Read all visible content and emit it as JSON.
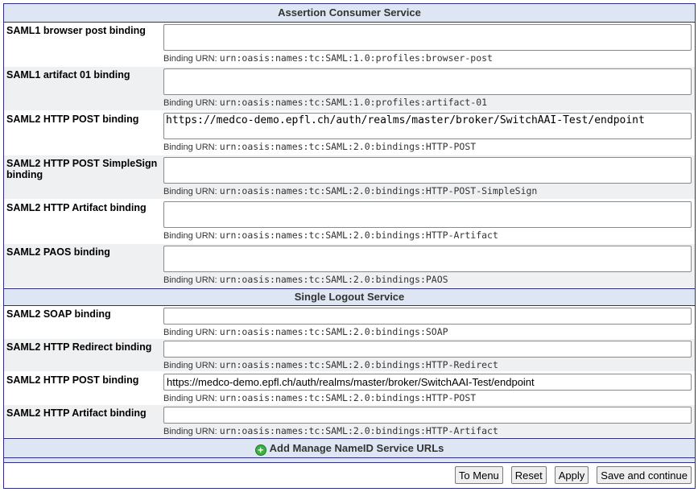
{
  "sections": {
    "acs": {
      "title": "Assertion Consumer Service",
      "urn_prefix": "Binding URN:",
      "rows": [
        {
          "label": "SAML1 browser post binding",
          "value": "",
          "urn": "urn:oasis:names:tc:SAML:1.0:profiles:browser-post"
        },
        {
          "label": "SAML1 artifact 01 binding",
          "value": "",
          "urn": "urn:oasis:names:tc:SAML:1.0:profiles:artifact-01"
        },
        {
          "label": "SAML2 HTTP POST binding",
          "value": "https://medco-demo.epfl.ch/auth/realms/master/broker/SwitchAAI-Test/endpoint",
          "urn": "urn:oasis:names:tc:SAML:2.0:bindings:HTTP-POST"
        },
        {
          "label": "SAML2 HTTP POST SimpleSign binding",
          "value": "",
          "urn": "urn:oasis:names:tc:SAML:2.0:bindings:HTTP-POST-SimpleSign"
        },
        {
          "label": "SAML2 HTTP Artifact binding",
          "value": "",
          "urn": "urn:oasis:names:tc:SAML:2.0:bindings:HTTP-Artifact"
        },
        {
          "label": "SAML2 PAOS binding",
          "value": "",
          "urn": "urn:oasis:names:tc:SAML:2.0:bindings:PAOS"
        }
      ]
    },
    "slo": {
      "title": "Single Logout Service",
      "urn_prefix": "Binding URN:",
      "rows": [
        {
          "label": "SAML2 SOAP binding",
          "value": "",
          "urn": "urn:oasis:names:tc:SAML:2.0:bindings:SOAP"
        },
        {
          "label": "SAML2 HTTP Redirect binding",
          "value": "",
          "urn": "urn:oasis:names:tc:SAML:2.0:bindings:HTTP-Redirect"
        },
        {
          "label": "SAML2 HTTP POST binding",
          "value": "https://medco-demo.epfl.ch/auth/realms/master/broker/SwitchAAI-Test/endpoint",
          "urn": "urn:oasis:names:tc:SAML:2.0:bindings:HTTP-POST"
        },
        {
          "label": "SAML2 HTTP Artifact binding",
          "value": "",
          "urn": "urn:oasis:names:tc:SAML:2.0:bindings:HTTP-Artifact"
        }
      ]
    }
  },
  "add_link": {
    "label": "Add Manage NameID Service URLs",
    "icon": "plus-circle-icon"
  },
  "buttons": {
    "to_menu": "To Menu",
    "reset": "Reset",
    "apply": "Apply",
    "save_continue": "Save and continue"
  },
  "colors": {
    "header_bg": "#dde6f2",
    "border": "#2e2e86",
    "row_alt": "#eef0f2"
  }
}
